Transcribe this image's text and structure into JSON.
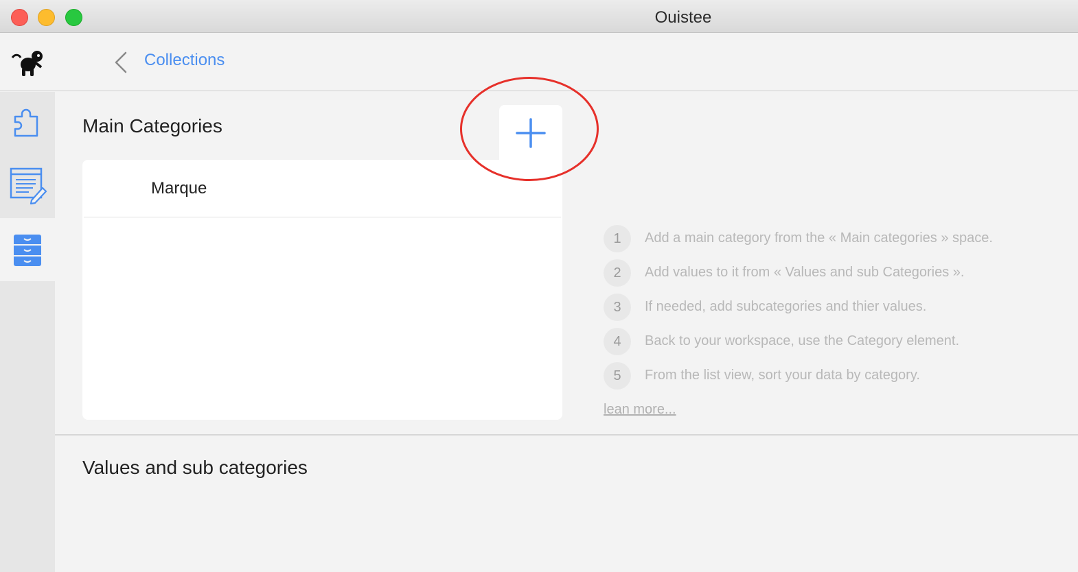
{
  "window": {
    "title": "Ouistee"
  },
  "toolbar": {
    "back_label": "Collections"
  },
  "sidebar": {
    "items": [
      {
        "icon": "puzzle-icon"
      },
      {
        "icon": "form-edit-icon"
      },
      {
        "icon": "cabinet-icon",
        "active": true
      }
    ]
  },
  "main_categories": {
    "title": "Main Categories",
    "add_icon": "plus-icon",
    "items": [
      {
        "label": "Marque"
      }
    ]
  },
  "values": {
    "title": "Values and sub categories"
  },
  "help": {
    "steps": [
      {
        "num": "1",
        "text": "Add a main category from the « Main categories » space."
      },
      {
        "num": "2",
        "text": "Add values to it from « Values and sub Categories »."
      },
      {
        "num": "3",
        "text": "If needed, add subcategories and thier values."
      },
      {
        "num": "4",
        "text": "Back to your workspace, use the Category element."
      },
      {
        "num": "5",
        "text": "From the list view, sort your data by category."
      }
    ],
    "learn_more": "lean more..."
  },
  "colors": {
    "accent": "#4a8ef0",
    "highlight": "#e6302a"
  }
}
